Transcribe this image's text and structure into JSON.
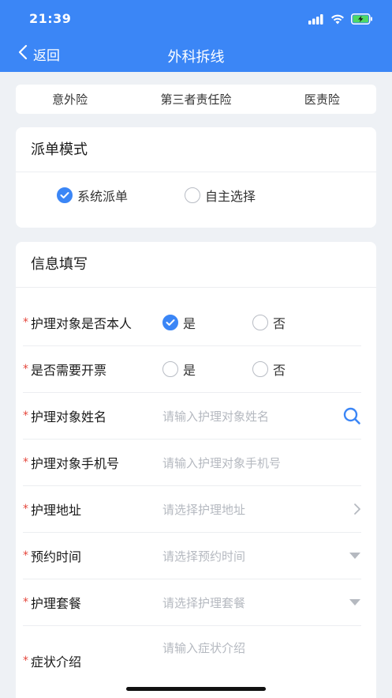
{
  "status_bar": {
    "time": "21:39"
  },
  "nav": {
    "back_label": "返回",
    "title": "外科拆线"
  },
  "tabs": [
    {
      "label": "意外险"
    },
    {
      "label": "第三者责任险"
    },
    {
      "label": "医责险"
    }
  ],
  "dispatch": {
    "title": "派单模式",
    "options": [
      {
        "label": "系统派单",
        "checked": true
      },
      {
        "label": "自主选择",
        "checked": false
      }
    ]
  },
  "info": {
    "title": "信息填写",
    "rows": [
      {
        "label": "护理对象是否本人",
        "required": "*",
        "yes": "是",
        "no": "否",
        "selected": "是"
      },
      {
        "label": "是否需要开票",
        "required": "*",
        "yes": "是",
        "no": "否",
        "selected": ""
      },
      {
        "label": "护理对象姓名",
        "required": "*",
        "placeholder": "请输入护理对象姓名",
        "icon": "search-icon"
      },
      {
        "label": "护理对象手机号",
        "required": "*",
        "placeholder": "请输入护理对象手机号"
      },
      {
        "label": "护理地址",
        "required": "*",
        "placeholder": "请选择护理地址",
        "icon": "chevron-right-icon"
      },
      {
        "label": "预约时间",
        "required": "*",
        "placeholder": "请选择预约时间",
        "icon": "caret-down-icon"
      },
      {
        "label": "护理套餐",
        "required": "*",
        "placeholder": "请选择护理套餐",
        "icon": "caret-down-icon"
      },
      {
        "label": "症状介绍",
        "required": "*",
        "placeholder": "请输入症状介绍"
      }
    ]
  },
  "colors": {
    "primary": "#3b86f6",
    "required": "#e5463b",
    "background": "#eef1f5"
  }
}
